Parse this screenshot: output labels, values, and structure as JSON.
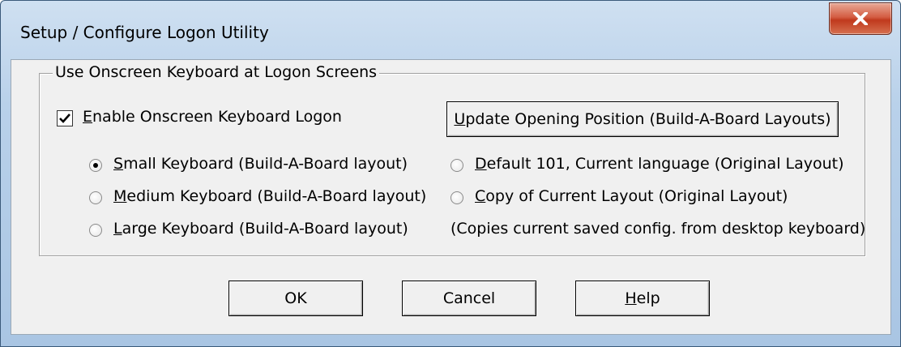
{
  "window": {
    "title": "Setup / Configure Logon Utility",
    "close_icon": "close-x-icon"
  },
  "group": {
    "legend": "Use Onscreen Keyboard at Logon Screens"
  },
  "enable_checkbox": {
    "checked": true,
    "label_hotkey": "E",
    "label_rest": "nable Onscreen Keyboard Logon"
  },
  "update_button": {
    "hotkey": "U",
    "rest": "pdate Opening Position (Build-A-Board Layouts)"
  },
  "radios": [
    {
      "hotkey": "S",
      "rest": "mall Keyboard (Build-A-Board layout)",
      "selected": true
    },
    {
      "hotkey": "M",
      "rest": "edium Keyboard (Build-A-Board layout)",
      "selected": false
    },
    {
      "hotkey": "L",
      "rest": "arge Keyboard (Build-A-Board layout)",
      "selected": false
    },
    {
      "hotkey": "D",
      "rest": "efault 101, Current language (Original Layout)",
      "selected": false
    },
    {
      "hotkey": "C",
      "rest": "opy of Current Layout (Original Layout)",
      "selected": false
    }
  ],
  "copy_note": "(Copies current saved config. from desktop keyboard)",
  "buttons": {
    "ok": "OK",
    "cancel": "Cancel",
    "help_hotkey": "H",
    "help_rest": "elp"
  }
}
